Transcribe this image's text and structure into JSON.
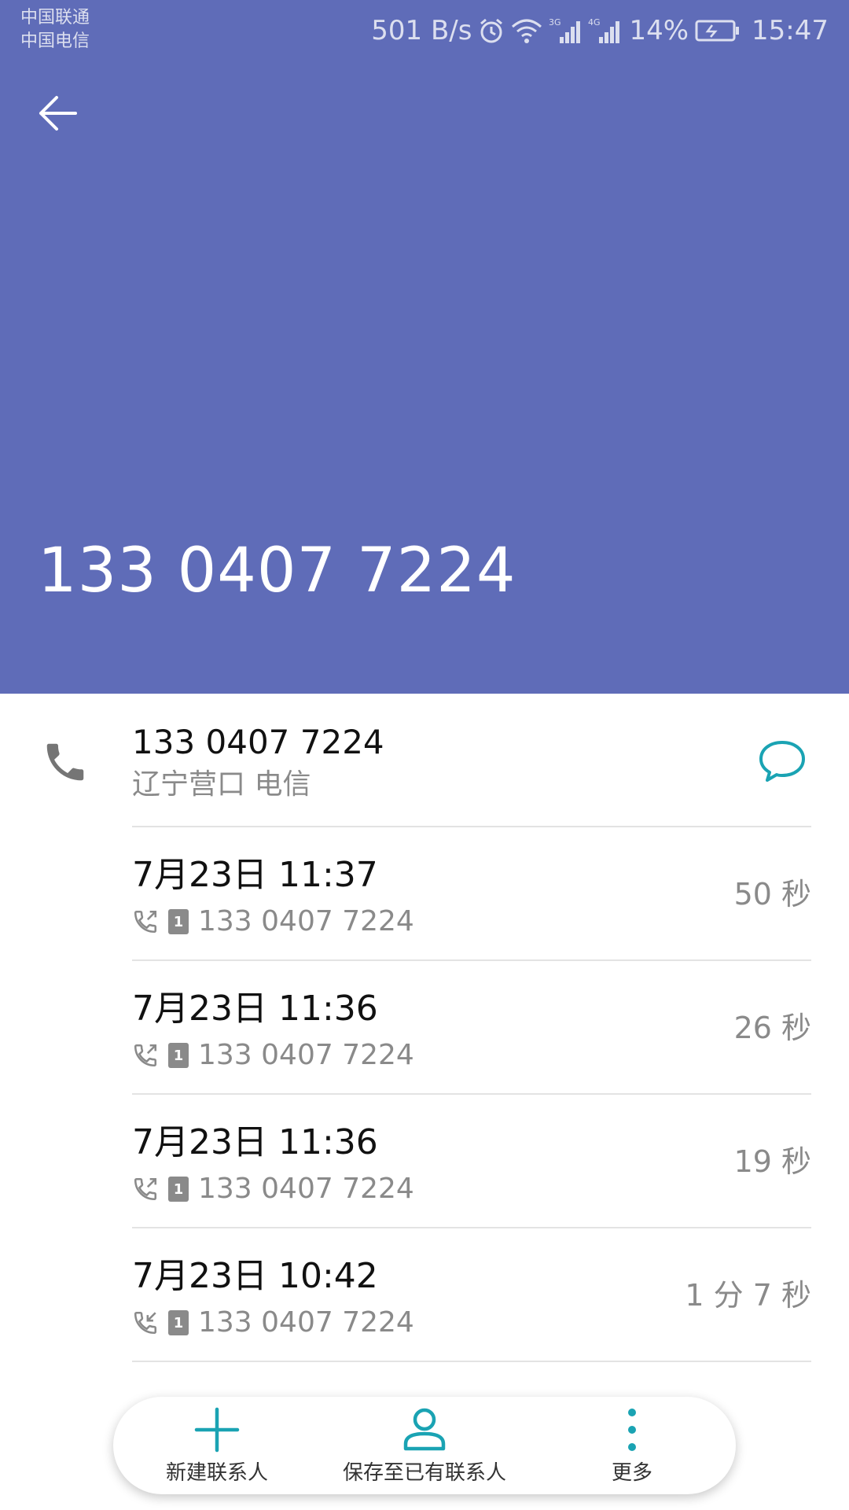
{
  "status_bar": {
    "carrier_1": "中国联通",
    "carrier_2": "中国电信",
    "net_speed": "501 B/s",
    "battery": "14%",
    "time": "15:47"
  },
  "header": {
    "number": "133 0407 7224",
    "background_color": "#5f6cb8"
  },
  "number_row": {
    "number": "133 0407 7224",
    "location": "辽宁营口 电信"
  },
  "calls": [
    {
      "time": "7月23日 11:37",
      "number": "133 0407 7224",
      "duration": "50 秒",
      "sim": "1",
      "direction": "outgoing"
    },
    {
      "time": "7月23日 11:36",
      "number": "133 0407 7224",
      "duration": "26 秒",
      "sim": "1",
      "direction": "outgoing"
    },
    {
      "time": "7月23日 11:36",
      "number": "133 0407 7224",
      "duration": "19 秒",
      "sim": "1",
      "direction": "outgoing"
    },
    {
      "time": "7月23日 10:42",
      "number": "133 0407 7224",
      "duration": "1 分 7 秒",
      "sim": "1",
      "direction": "incoming"
    }
  ],
  "bottom_bar": {
    "new_contact": "新建联系人",
    "save_existing": "保存至已有联系人",
    "more": "更多",
    "accent_color": "#1aa3b3"
  }
}
